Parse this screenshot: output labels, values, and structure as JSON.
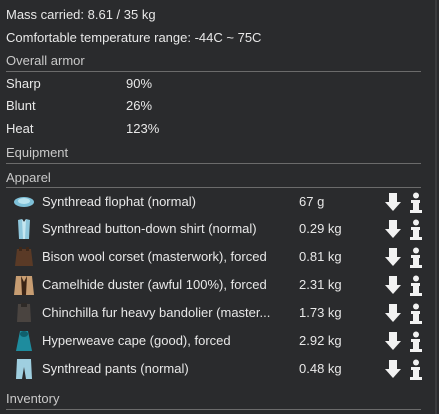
{
  "summary": {
    "mass_carried": "Mass carried: 8.61 / 35 kg",
    "temperature": "Comfortable temperature range: -44C ~ 75C"
  },
  "armor": {
    "title": "Overall armor",
    "stats": [
      {
        "label": "Sharp",
        "value": "90%"
      },
      {
        "label": "Blunt",
        "value": "26%"
      },
      {
        "label": "Heat",
        "value": "123%"
      }
    ]
  },
  "equipment": {
    "title": "Equipment"
  },
  "apparel": {
    "title": "Apparel",
    "items": [
      {
        "label": "Synthread flophat (normal)",
        "mass": "67 g",
        "icon": "flophat-icon",
        "color": "#7ec0d8"
      },
      {
        "label": "Synthread button-down shirt (normal)",
        "mass": "0.29 kg",
        "icon": "shirt-icon",
        "color": "#8fc7dc"
      },
      {
        "label": "Bison wool corset (masterwork), forced",
        "mass": "0.81 kg",
        "icon": "corset-icon",
        "color": "#5a3a26"
      },
      {
        "label": "Camelhide duster (awful 100%), forced",
        "mass": "2.31 kg",
        "icon": "duster-icon",
        "color": "#c79d72"
      },
      {
        "label": "Chinchilla fur heavy bandolier (master...",
        "mass": "1.73 kg",
        "icon": "bandolier-icon",
        "color": "#4a4440"
      },
      {
        "label": "Hyperweave cape (good), forced",
        "mass": "2.92 kg",
        "icon": "cape-icon",
        "color": "#1e8c9e"
      },
      {
        "label": "Synthread pants (normal)",
        "mass": "0.48 kg",
        "icon": "pants-icon",
        "color": "#9fcfe0"
      }
    ]
  },
  "inventory": {
    "title": "Inventory"
  }
}
